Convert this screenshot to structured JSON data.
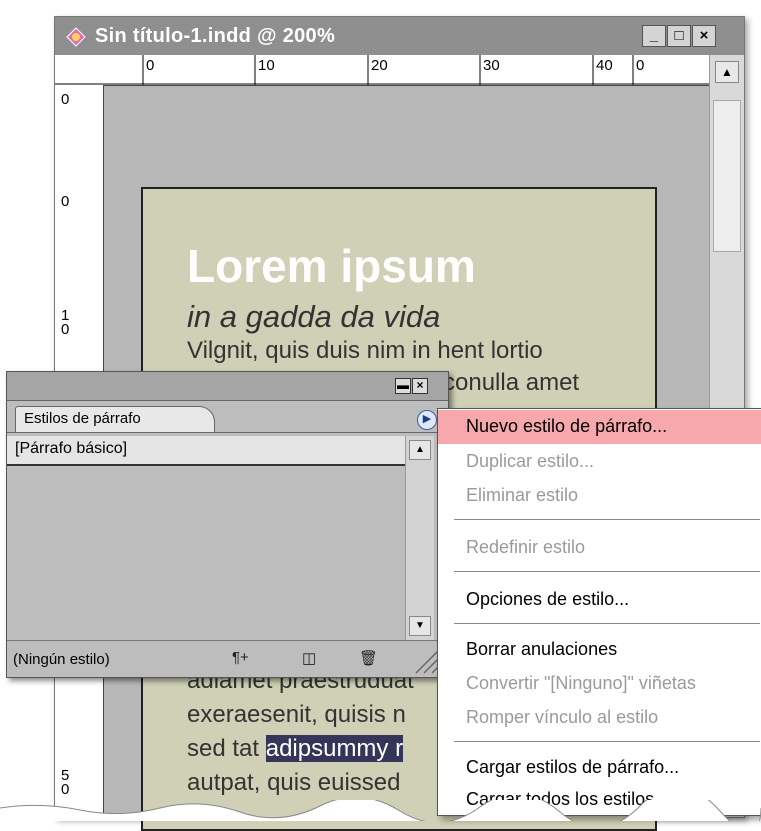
{
  "window": {
    "title": "Sin título-1.indd @ 200%",
    "controls": {
      "minimize": "_",
      "maximize": "□",
      "close": "×"
    }
  },
  "ruler": {
    "top_labels": [
      "0",
      "10",
      "20",
      "30",
      "40",
      "0"
    ],
    "left_labels": [
      "0",
      "0",
      "1\n0",
      "5\n0"
    ]
  },
  "page_text": {
    "heading": "Lorem ipsum",
    "subheading": "in a gadda da vida",
    "line1": "Vilgnit, quis duis nim in hent lortio",
    "line2_tail": "conulla amet",
    "line3": "adiamet praestruduat",
    "line4": "exeraesenit, quisis n",
    "line5_pre": "sed tat ",
    "line5_hl": "adipsummy r",
    "line6": "autpat, quis euissed"
  },
  "panel": {
    "tab_label": "Estilos de párrafo",
    "items": [
      "[Párrafo básico]"
    ],
    "status": "(Ningún estilo)",
    "footer_icons": [
      "new-style-from-selection-icon",
      "new-style-icon",
      "trash-icon"
    ],
    "controls": {
      "minimize": "▬",
      "close": "×"
    }
  },
  "menu": {
    "items": [
      {
        "label": "Nuevo estilo de párrafo...",
        "enabled": true,
        "highlighted": true
      },
      {
        "label": "Duplicar estilo...",
        "enabled": false
      },
      {
        "label": "Eliminar estilo",
        "enabled": false
      },
      {
        "label": "Redefinir estilo",
        "enabled": false
      },
      {
        "label": "Opciones de estilo...",
        "enabled": true
      },
      {
        "label": "Borrar anulaciones",
        "enabled": true
      },
      {
        "label": "Convertir \"[Ninguno]\" viñetas",
        "enabled": false
      },
      {
        "label": "Romper vínculo al estilo",
        "enabled": false
      },
      {
        "label": "Cargar estilos de párrafo...",
        "enabled": true
      },
      {
        "label": "Cargar todos los estilos...",
        "enabled": true
      }
    ],
    "highlight_color": "#f6a8ad"
  },
  "colors": {
    "page_fill": "#cfd0b5",
    "selection": "#35355a"
  }
}
